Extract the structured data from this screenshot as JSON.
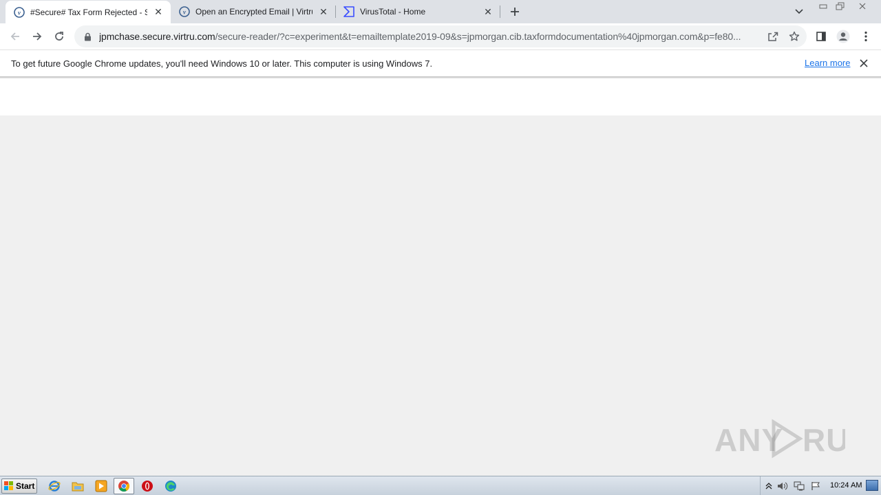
{
  "tabs": [
    {
      "title": "#Secure# Tax Form Rejected - Secu",
      "favicon": "virtru-icon",
      "active": true
    },
    {
      "title": "Open an Encrypted Email | Virtru",
      "favicon": "virtru-icon",
      "active": false
    },
    {
      "title": "VirusTotal - Home",
      "favicon": "virustotal-icon",
      "active": false
    }
  ],
  "toolbar": {
    "url_host": "jpmchase.secure.virtru.com",
    "url_path": "/secure-reader/?c=experiment&t=emailtemplate2019-09&s=jpmorgan.cib.taxformdocumentation%40jpmorgan.com&p=fe80..."
  },
  "infobar": {
    "message": "To get future Google Chrome updates, you'll need Windows 10 or later. This computer is using Windows 7.",
    "link": "Learn more"
  },
  "watermark": {
    "text": "ANY RUN"
  },
  "taskbar": {
    "start_label": "Start",
    "clock": "10:24 AM"
  },
  "colors": {
    "tabstrip": "#dee1e6",
    "accent": "#1a73e8",
    "page_background": "#f0f0f0"
  }
}
